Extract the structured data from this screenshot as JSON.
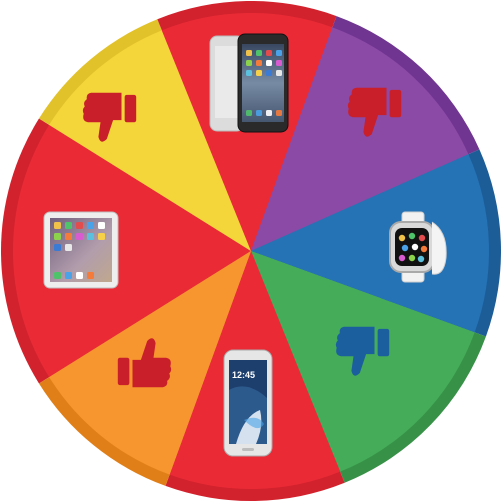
{
  "wheel": {
    "colors": {
      "red": "#ea2b36",
      "red_rim": "#d2222d",
      "yellow": "#f5d63a",
      "yellow_rim": "#e2c22a",
      "purple": "#8a4aa6",
      "purple_rim": "#6f3590",
      "blue": "#2572b5",
      "blue_rim": "#1c5d98",
      "green": "#45ac59",
      "green_rim": "#379147",
      "orange": "#f7962e",
      "orange_rim": "#e07f18",
      "icon_on_red": "#c91f2a",
      "icon_on_blue": "#1b5f9e"
    },
    "segments": [
      {
        "name": "segment-thumbs-down-top-left",
        "color": "red",
        "prize": "thumbs-down-icon"
      },
      {
        "name": "segment-iphone",
        "color": "yellow",
        "prize": "iphone-icon"
      },
      {
        "name": "segment-thumbs-down-top-right",
        "color": "red",
        "prize": "thumbs-down-icon"
      },
      {
        "name": "segment-apple-watch",
        "color": "purple",
        "prize": "apple-watch-icon"
      },
      {
        "name": "segment-thumbs-down-bottom-right",
        "color": "blue",
        "prize": "thumbs-down-icon"
      },
      {
        "name": "segment-galaxy-phone",
        "color": "green",
        "prize": "galaxy-phone-icon"
      },
      {
        "name": "segment-thumbs-up-bottom-left",
        "color": "red",
        "prize": "thumbs-up-icon"
      },
      {
        "name": "segment-ipad",
        "color": "orange",
        "prize": "ipad-icon"
      }
    ]
  },
  "devices": {
    "galaxy_time": "12:45"
  }
}
